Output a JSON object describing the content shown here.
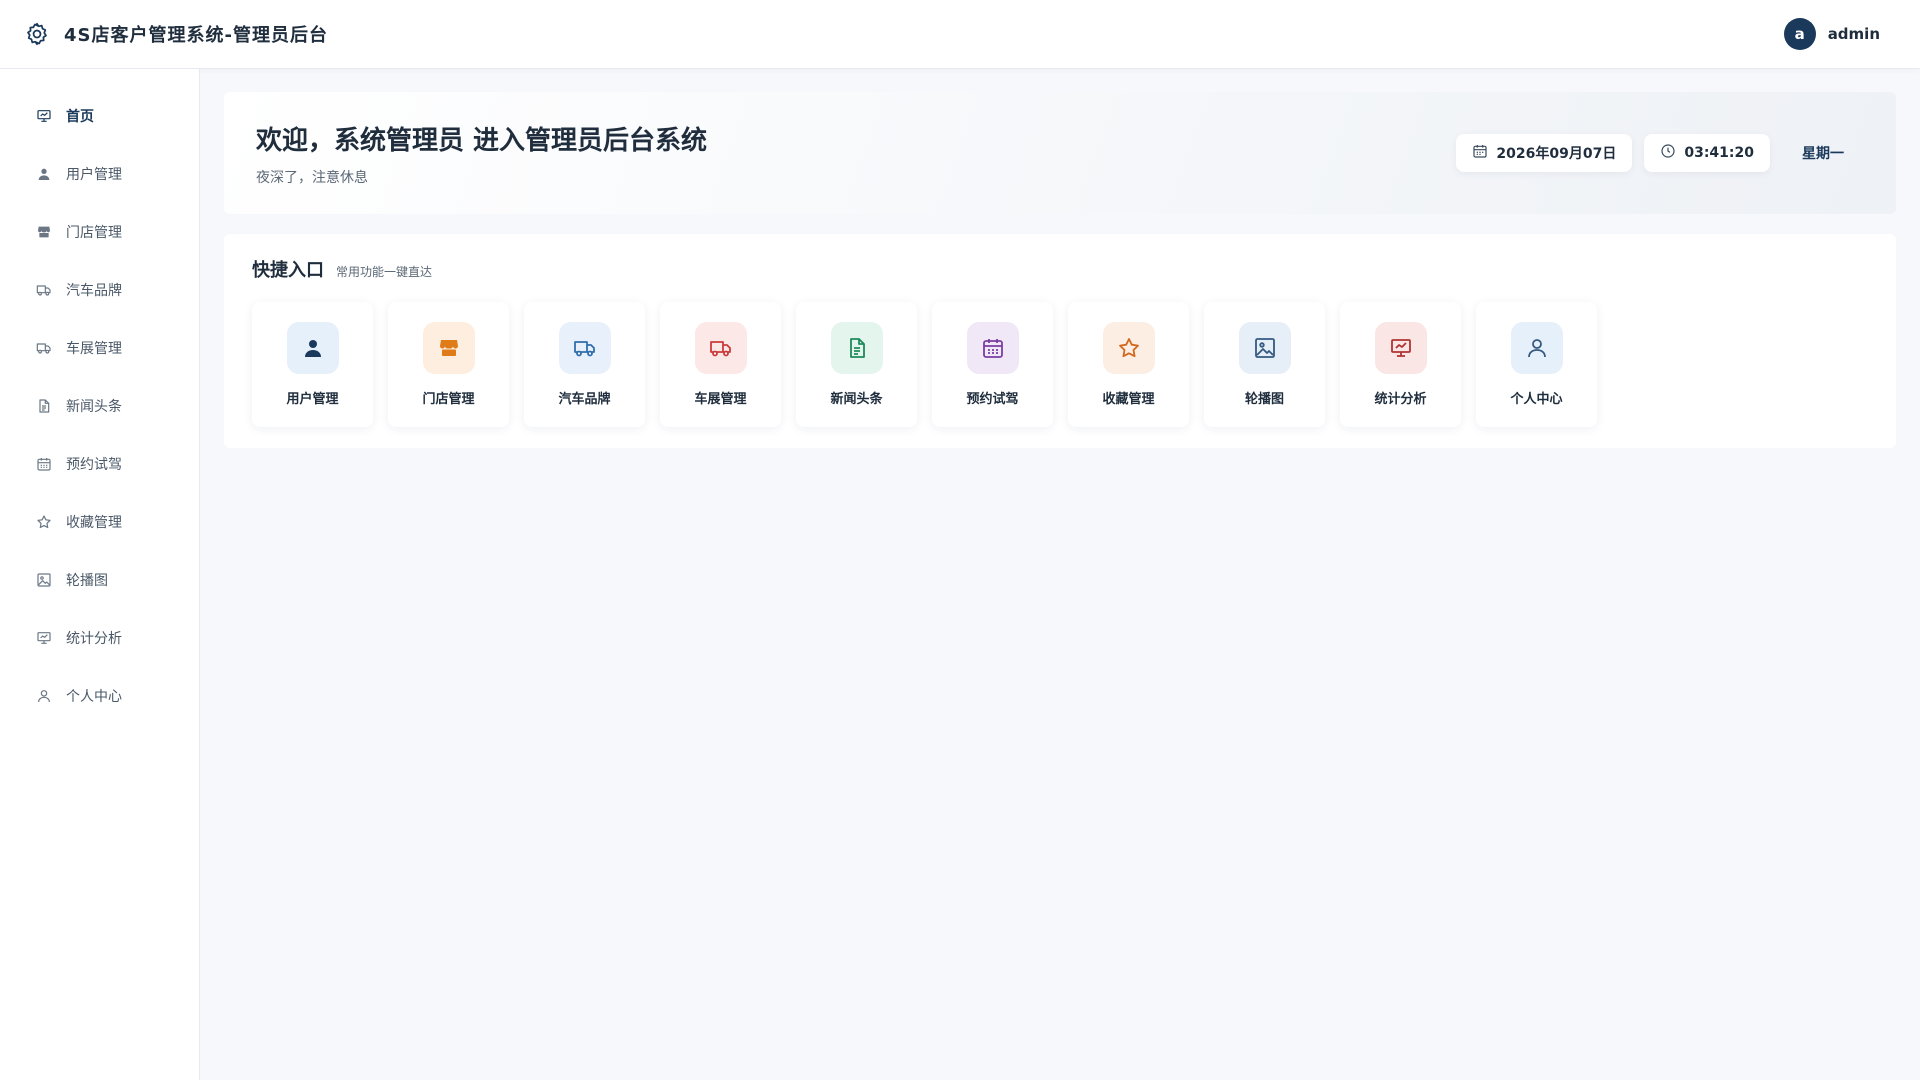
{
  "header": {
    "title": "4S店客户管理系统-管理员后台",
    "logo_icon": "gear-icon",
    "user": {
      "avatar_letter": "a",
      "name": "admin"
    }
  },
  "sidebar": {
    "items": [
      {
        "label": "首页",
        "icon": "presentation-chart-icon",
        "active": true
      },
      {
        "label": "用户管理",
        "icon": "user-icon"
      },
      {
        "label": "门店管理",
        "icon": "store-icon"
      },
      {
        "label": "汽车品牌",
        "icon": "truck-icon"
      },
      {
        "label": "车展管理",
        "icon": "truck-icon"
      },
      {
        "label": "新闻头条",
        "icon": "document-icon"
      },
      {
        "label": "预约试驾",
        "icon": "calendar-icon"
      },
      {
        "label": "收藏管理",
        "icon": "star-icon"
      },
      {
        "label": "轮播图",
        "icon": "image-icon"
      },
      {
        "label": "统计分析",
        "icon": "presentation-chart-icon"
      },
      {
        "label": "个人中心",
        "icon": "user-outline-icon"
      }
    ]
  },
  "welcome": {
    "title": "欢迎，系统管理员 进入管理员后台系统",
    "subtitle": "夜深了，注意休息",
    "date": "2026年09月07日",
    "time": "03:41:20",
    "weekday": "星期一"
  },
  "quick": {
    "title": "快捷入口",
    "subtitle": "常用功能一键直达",
    "cards": [
      {
        "label": "用户管理",
        "icon": "user-icon",
        "bg": "#e6f0fa",
        "fg": "#1b3a5b"
      },
      {
        "label": "门店管理",
        "icon": "store-icon",
        "bg": "#fdeee0",
        "fg": "#e07b1a"
      },
      {
        "label": "汽车品牌",
        "icon": "truck-icon",
        "bg": "#e8f1fb",
        "fg": "#2f6fad"
      },
      {
        "label": "车展管理",
        "icon": "truck-icon",
        "bg": "#fde8e8",
        "fg": "#cc3b3b"
      },
      {
        "label": "新闻头条",
        "icon": "document-icon",
        "bg": "#e3f5ec",
        "fg": "#1f8a5a"
      },
      {
        "label": "预约试驾",
        "icon": "calendar-icon",
        "bg": "#f1e8f7",
        "fg": "#7a3ea3"
      },
      {
        "label": "收藏管理",
        "icon": "star-icon",
        "bg": "#fdeee4",
        "fg": "#d2691e"
      },
      {
        "label": "轮播图",
        "icon": "image-icon",
        "bg": "#e6eef7",
        "fg": "#355a82"
      },
      {
        "label": "统计分析",
        "icon": "presentation-chart-icon",
        "bg": "#fbe6e6",
        "fg": "#b03434"
      },
      {
        "label": "个人中心",
        "icon": "user-outline-icon",
        "bg": "#e6f0fa",
        "fg": "#355a82"
      }
    ]
  }
}
